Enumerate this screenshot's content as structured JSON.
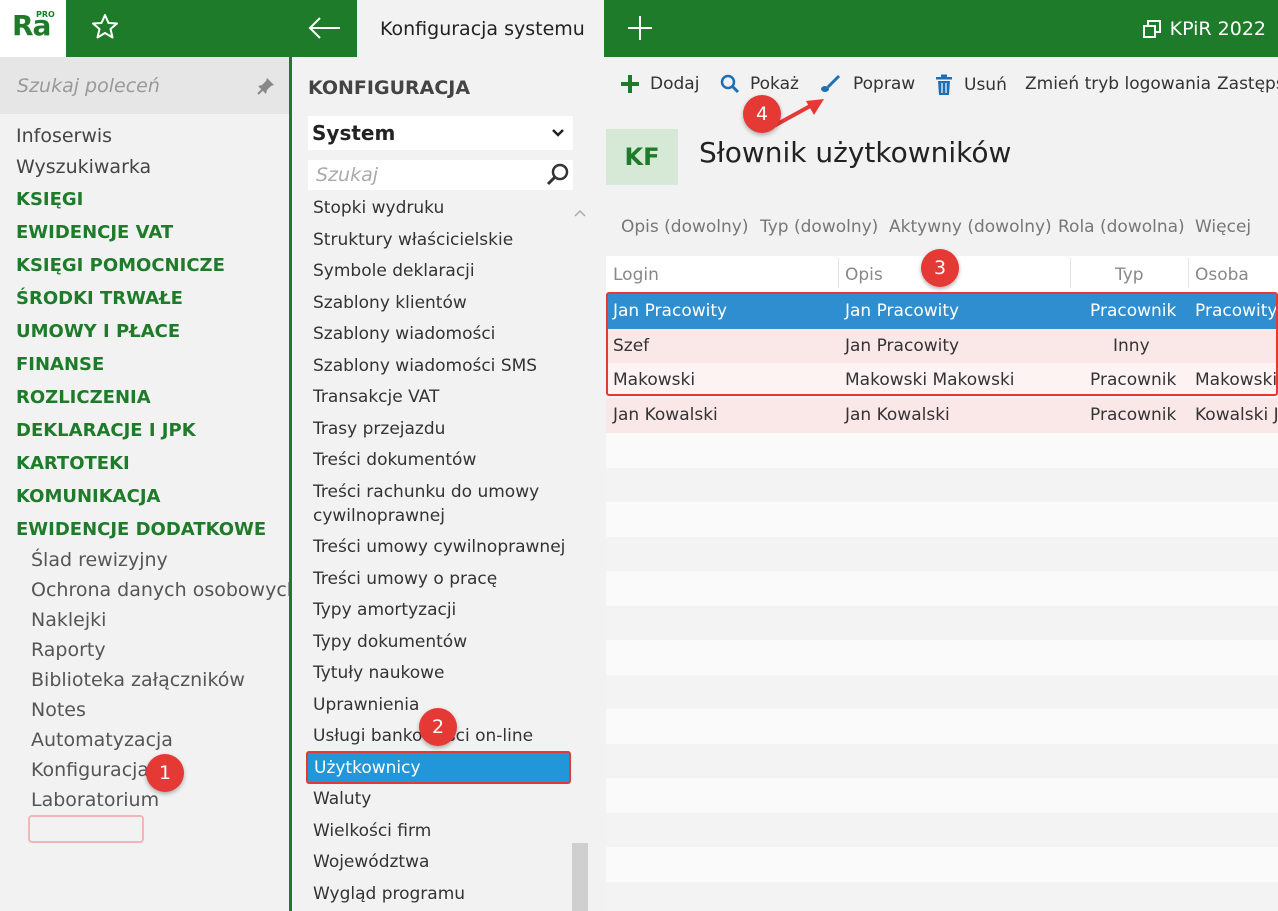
{
  "topbar": {
    "logo_text": "Ra",
    "logo_badge": "PRO",
    "active_tab": "Konfiguracja systemu",
    "product": "KPiR 2022"
  },
  "sidebar": {
    "search_placeholder": "Szukaj poleceń",
    "top_items": [
      "Infoserwis",
      "Wyszukiwarka"
    ],
    "sections": [
      "KSIĘGI",
      "EWIDENCJE VAT",
      "KSIĘGI POMOCNICZE",
      "ŚRODKI TRWAŁE",
      "UMOWY I PŁACE",
      "FINANSE",
      "ROZLICZENIA",
      "DEKLARACJE I JPK",
      "KARTOTEKI",
      "KOMUNIKACJA",
      "EWIDENCJE DODATKOWE"
    ],
    "sub_items": [
      "Ślad rewizyjny",
      "Ochrona danych osobowych",
      "Naklejki",
      "Raporty",
      "Biblioteka załączników",
      "Notes",
      "Automatyzacja",
      "Konfiguracja",
      "Laboratorium"
    ]
  },
  "config": {
    "title": "KONFIGURACJA",
    "select_value": "System",
    "search_placeholder": "Szukaj",
    "items": [
      "Stopki wydruku",
      "Struktury właścicielskie",
      "Symbole deklaracji",
      "Szablony klientów",
      "Szablony wiadomości",
      "Szablony wiadomości SMS",
      "Transakcje VAT",
      "Trasy przejazdu",
      "Treści dokumentów",
      "Treści rachunku do umowy",
      "cywilnoprawnej",
      "Treści umowy cywilnoprawnej",
      "Treści umowy o pracę",
      "Typy amortyzacji",
      "Typy dokumentów",
      "Tytuły naukowe",
      "Uprawnienia",
      "Usługi bankowości on-line"
    ],
    "selected": "Użytkownicy",
    "after_items": [
      "Waluty",
      "Wielkości firm",
      "Województwa",
      "Wygląd programu"
    ]
  },
  "toolbar": {
    "add": "Dodaj",
    "show": "Pokaż",
    "edit": "Popraw",
    "delete": "Usuń",
    "login_mode": "Zmień tryb logowania",
    "substitute": "Zastęps"
  },
  "main": {
    "badge": "KF",
    "title": "Słownik użytkowników",
    "filters": [
      "Opis (dowolny)",
      "Typ (dowolny)",
      "Aktywny (dowolny)",
      "Rola (dowolna)",
      "Więcej"
    ]
  },
  "table": {
    "columns": [
      "Login",
      "Opis",
      "Typ",
      "Osoba"
    ],
    "rows": [
      [
        "Jan Pracowity",
        "Jan Pracowity",
        "Pracownik",
        "Pracowity J"
      ],
      [
        "Szef",
        "Jan Pracowity",
        "Inny",
        ""
      ],
      [
        "Makowski",
        "Makowski Makowski",
        "Pracownik",
        "Makowski M"
      ],
      [
        "Jan Kowalski",
        "Jan Kowalski",
        "Pracownik",
        "Kowalski Ja"
      ]
    ]
  },
  "annotations": [
    "1",
    "2",
    "3",
    "4"
  ],
  "colors": {
    "brand": "#1e7b2a",
    "selection": "#2196d9",
    "annotation": "#e53935"
  }
}
